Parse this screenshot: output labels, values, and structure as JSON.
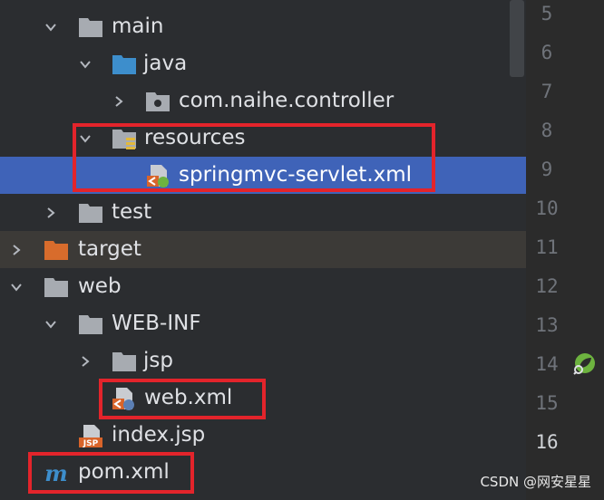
{
  "project_tree": {
    "items": [
      {
        "label": "main"
      },
      {
        "label": "java"
      },
      {
        "label": "com.naihe.controller"
      },
      {
        "label": "resources"
      },
      {
        "label": "springmvc-servlet.xml"
      },
      {
        "label": "test"
      },
      {
        "label": "target"
      },
      {
        "label": "web"
      },
      {
        "label": "WEB-INF"
      },
      {
        "label": "jsp"
      },
      {
        "label": "web.xml"
      },
      {
        "label": "index.jsp"
      },
      {
        "label": "pom.xml"
      }
    ]
  },
  "gutter": {
    "line_numbers": [
      "5",
      "6",
      "7",
      "8",
      "9",
      "10",
      "11",
      "12",
      "13",
      "14",
      "15",
      "16"
    ]
  },
  "icons": {
    "folder": "folder-icon",
    "source_root": "java-source-folder-icon",
    "package": "package-icon",
    "resources_root": "resources-folder-icon",
    "spring_xml": "spring-xml-file-icon",
    "excluded_folder": "excluded-folder-icon",
    "web_xml": "web-xml-file-icon",
    "jsp": "jsp-file-icon",
    "maven": "maven-pom-icon",
    "spring_gutter": "spring-bean-gutter-icon"
  },
  "colors": {
    "selection": "#3f63b8",
    "highlight_box": "#e3242b",
    "target_folder": "#d86c2c",
    "source_folder": "#3d8ecc"
  },
  "watermark": "CSDN @网安星星"
}
